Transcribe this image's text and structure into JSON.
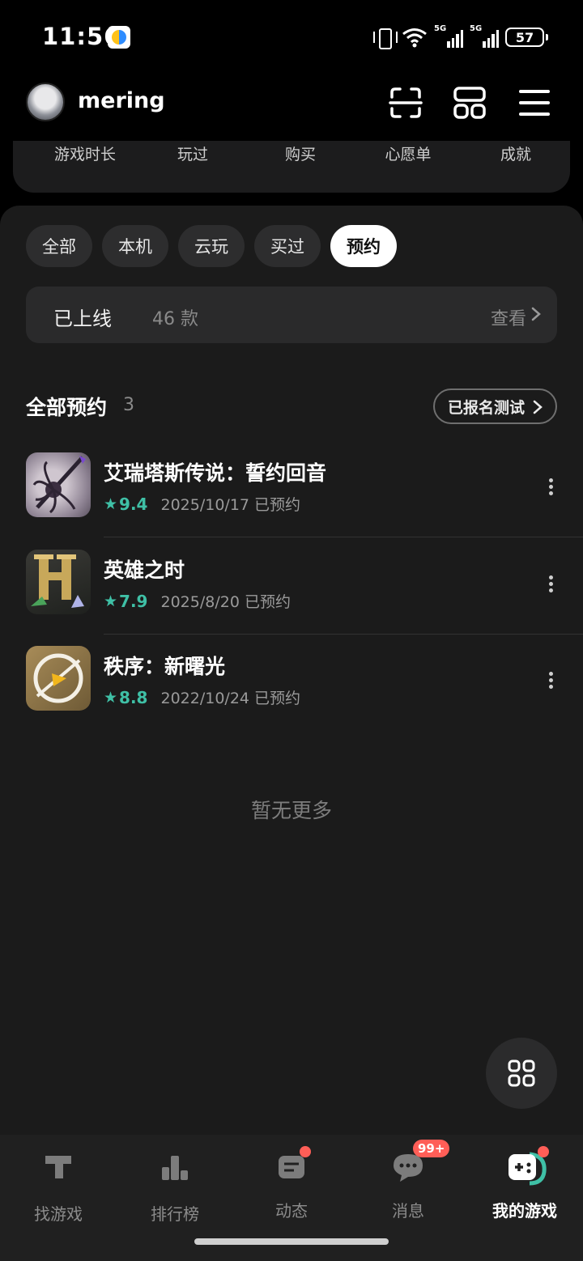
{
  "status_bar": {
    "time": "11:56",
    "network_1": "5G",
    "network_2": "5G",
    "battery": "57"
  },
  "header": {
    "username": "mering",
    "icons": [
      "scan-icon",
      "grid-icon",
      "menu-icon"
    ]
  },
  "stats": [
    "游戏时长",
    "玩过",
    "购买",
    "心愿单",
    "成就"
  ],
  "filters": {
    "chips": [
      "全部",
      "本机",
      "云玩",
      "买过",
      "预约"
    ],
    "active": "预约"
  },
  "online": {
    "title": "已上线",
    "count": "46 款",
    "view": "查看"
  },
  "section": {
    "title": "全部预约",
    "count": "3",
    "test_button": "已报名测试"
  },
  "games": [
    {
      "name": "艾瑞塔斯传说：誓约回音",
      "rating": "9.4",
      "date": "2025/10/17 已预约"
    },
    {
      "name": "英雄之时",
      "rating": "7.9",
      "date": "2025/8/20 已预约"
    },
    {
      "name": "秩序：新曙光",
      "rating": "8.8",
      "date": "2022/10/24 已预约"
    }
  ],
  "no_more": "暂无更多",
  "nav": [
    {
      "label": "找游戏",
      "icon": "find-games-icon"
    },
    {
      "label": "排行榜",
      "icon": "ranking-icon"
    },
    {
      "label": "动态",
      "icon": "feed-icon"
    },
    {
      "label": "消息",
      "icon": "message-icon",
      "badge": "99+"
    },
    {
      "label": "我的游戏",
      "icon": "my-games-icon"
    }
  ],
  "colors": {
    "accent": "#3fc0a6",
    "notification": "#ff5e57",
    "background": "#1b1b1b"
  }
}
